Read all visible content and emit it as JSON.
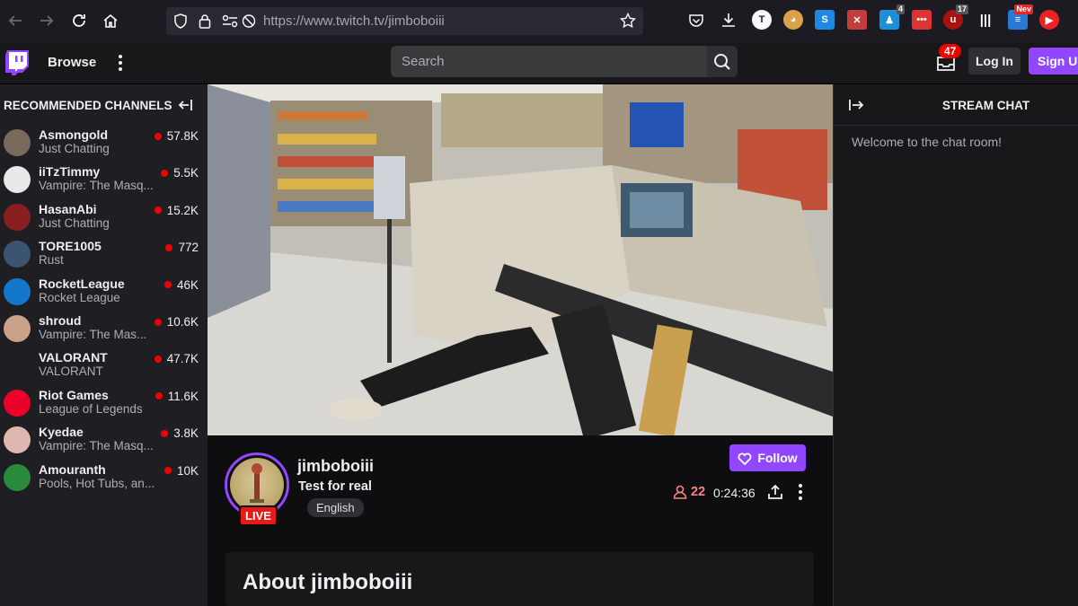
{
  "browser": {
    "url": "https://www.twitch.tv/jimboboiii",
    "extension_badges": {
      "ext1": "4",
      "ext2": "17",
      "ext3": "Nev"
    }
  },
  "topnav": {
    "browse_label": "Browse",
    "search_placeholder": "Search",
    "inbox_count": "47",
    "login_label": "Log In",
    "signup_label": "Sign Up"
  },
  "sidebar": {
    "header": "RECOMMENDED CHANNELS",
    "channels": [
      {
        "name": "Asmongold",
        "game": "Just Chatting",
        "viewers": "57.8K",
        "color": "#7a6a5c"
      },
      {
        "name": "iiTzTimmy",
        "game": "Vampire: The Masq...",
        "viewers": "5.5K",
        "color": "#e9e9ea"
      },
      {
        "name": "HasanAbi",
        "game": "Just Chatting",
        "viewers": "15.2K",
        "color": "#8a1f1f"
      },
      {
        "name": "TORE1005",
        "game": "Rust",
        "viewers": "772",
        "color": "#3b5570"
      },
      {
        "name": "RocketLeague",
        "game": "Rocket League",
        "viewers": "46K",
        "color": "#1477c9"
      },
      {
        "name": "shroud",
        "game": "Vampire: The Mas...",
        "viewers": "10.6K",
        "color": "#c9a088"
      },
      {
        "name": "VALORANT",
        "game": "VALORANT",
        "viewers": "47.7K",
        "color": "#1f1f23"
      },
      {
        "name": "Riot Games",
        "game": "League of Legends",
        "viewers": "11.6K",
        "color": "#eb0029"
      },
      {
        "name": "Kyedae",
        "game": "Vampire: The Masq...",
        "viewers": "3.8K",
        "color": "#e0b7b0"
      },
      {
        "name": "Amouranth",
        "game": "Pools, Hot Tubs, an...",
        "viewers": "10K",
        "color": "#2a8a3c"
      }
    ]
  },
  "stream": {
    "channel": "jimboboiii",
    "title": "Test for real",
    "tag": "English",
    "live_label": "LIVE",
    "follow_label": "Follow",
    "viewers": "22",
    "uptime": "0:24:36",
    "about_title": "About jimboboiii"
  },
  "chat": {
    "title": "STREAM CHAT",
    "welcome": "Welcome to the chat room!"
  },
  "colors": {
    "brand": "#9147ff",
    "live": "#eb0400"
  }
}
